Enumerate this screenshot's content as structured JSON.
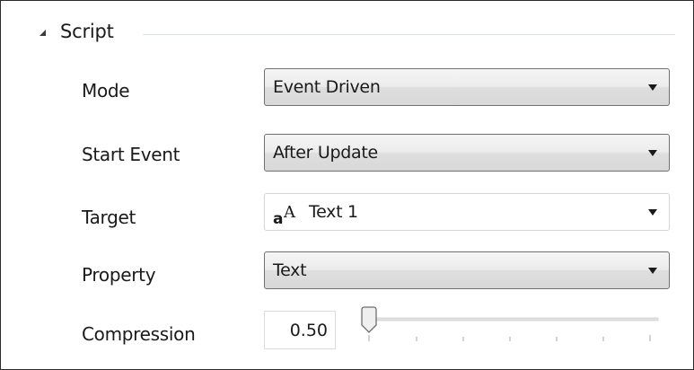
{
  "section": {
    "title": "Script",
    "collapse_icon": "collapse-triangle-icon"
  },
  "mode": {
    "label": "Mode",
    "value": "Event Driven"
  },
  "start_event": {
    "label": "Start Event",
    "value": "After Update"
  },
  "target": {
    "label": "Target",
    "value": "Text 1",
    "icon": "text-object-icon",
    "icon_glyph_small": "a",
    "icon_glyph_large": "A"
  },
  "property": {
    "label": "Property",
    "value": "Text"
  },
  "compression": {
    "label": "Compression",
    "value": "0.50",
    "slider_fraction": 0.0
  },
  "colors": {
    "border": "#2b2b2b",
    "combo_border": "#707070",
    "rule": "#d7dee6"
  }
}
